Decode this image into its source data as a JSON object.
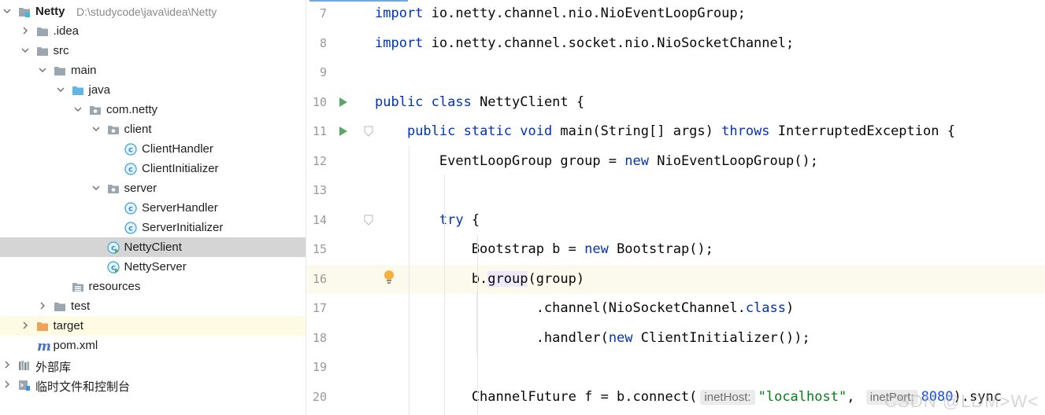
{
  "project_tree": {
    "items": [
      {
        "label": "Netty",
        "path": "D:\\studycode\\java\\idea\\Netty",
        "icon": "module-folder-icon",
        "expanded": true
      },
      {
        "label": ".idea",
        "icon": "folder-icon",
        "expanded": false
      },
      {
        "label": "src",
        "icon": "folder-icon",
        "expanded": true
      },
      {
        "label": "main",
        "icon": "folder-icon",
        "expanded": true
      },
      {
        "label": "java",
        "icon": "source-folder-icon",
        "expanded": true
      },
      {
        "label": "com.netty",
        "icon": "package-icon",
        "expanded": true
      },
      {
        "label": "client",
        "icon": "package-icon",
        "expanded": true
      },
      {
        "label": "ClientHandler",
        "icon": "class-icon"
      },
      {
        "label": "ClientInitializer",
        "icon": "class-icon"
      },
      {
        "label": "server",
        "icon": "package-icon",
        "expanded": true
      },
      {
        "label": "ServerHandler",
        "icon": "class-icon"
      },
      {
        "label": "ServerInitializer",
        "icon": "class-icon"
      },
      {
        "label": "NettyClient",
        "icon": "runnable-class-icon",
        "selected": true
      },
      {
        "label": "NettyServer",
        "icon": "runnable-class-icon"
      },
      {
        "label": "resources",
        "icon": "resources-folder-icon"
      },
      {
        "label": "test",
        "icon": "folder-icon",
        "expanded": false
      },
      {
        "label": "target",
        "icon": "excluded-folder-icon",
        "expanded": false
      },
      {
        "label": "pom.xml",
        "icon": "maven-icon"
      },
      {
        "label": "外部库",
        "icon": "libraries-icon",
        "expanded": false
      },
      {
        "label": "临时文件和控制台",
        "icon": "scratches-icon",
        "expanded": false
      }
    ]
  },
  "editor": {
    "lines": [
      {
        "number": "7",
        "tokens": [
          {
            "t": "import",
            "c": "kw"
          },
          {
            "t": " io.netty.channel.nio.NioEventLoopGroup;"
          }
        ]
      },
      {
        "number": "8",
        "tokens": [
          {
            "t": "import",
            "c": "kw"
          },
          {
            "t": " io.netty.channel.socket.nio.NioSocketChannel;"
          }
        ]
      },
      {
        "number": "9",
        "tokens": []
      },
      {
        "number": "10",
        "run": true,
        "tokens": [
          {
            "t": "public class",
            "c": "kw"
          },
          {
            "t": " NettyClient {"
          }
        ]
      },
      {
        "number": "11",
        "run": true,
        "fold": true,
        "tokens": [
          {
            "t": "    "
          },
          {
            "t": "public static void",
            "c": "kw"
          },
          {
            "t": " main(String[] args) "
          },
          {
            "t": "throws",
            "c": "kw"
          },
          {
            "t": " InterruptedException {"
          }
        ]
      },
      {
        "number": "12",
        "tokens": [
          {
            "t": "        EventLoopGroup group = "
          },
          {
            "t": "new",
            "c": "kw"
          },
          {
            "t": " NioEventLoopGroup();"
          }
        ]
      },
      {
        "number": "13",
        "tokens": []
      },
      {
        "number": "14",
        "fold": true,
        "tokens": [
          {
            "t": "        "
          },
          {
            "t": "try",
            "c": "kw"
          },
          {
            "t": " {"
          }
        ]
      },
      {
        "number": "15",
        "tokens": [
          {
            "t": "            Bootstrap b = "
          },
          {
            "t": "new",
            "c": "kw"
          },
          {
            "t": " Bootstrap();"
          }
        ]
      },
      {
        "number": "16",
        "caret": true,
        "bulb": true,
        "tokens": [
          {
            "t": "            b."
          },
          {
            "t": "group",
            "c": "hl"
          },
          {
            "t": "(group)"
          }
        ]
      },
      {
        "number": "17",
        "tokens": [
          {
            "t": "                    .channel(NioSocketChannel."
          },
          {
            "t": "class",
            "c": "kw"
          },
          {
            "t": ")"
          }
        ]
      },
      {
        "number": "18",
        "tokens": [
          {
            "t": "                    .handler("
          },
          {
            "t": "new",
            "c": "kw"
          },
          {
            "t": " ClientInitializer());"
          }
        ]
      },
      {
        "number": "19",
        "tokens": []
      },
      {
        "number": "20",
        "tokens": [
          {
            "t": "            ChannelFuture f = b.connect("
          },
          {
            "t": "inetHost:",
            "c": "hint"
          },
          {
            "t": "\"localhost\"",
            "c": "str"
          },
          {
            "t": ", "
          },
          {
            "t": "inetPort:",
            "c": "hint"
          },
          {
            "t": "8080",
            "c": "num"
          },
          {
            "t": ").sync"
          }
        ]
      }
    ]
  },
  "watermark": "CSDN @LDM>W<"
}
